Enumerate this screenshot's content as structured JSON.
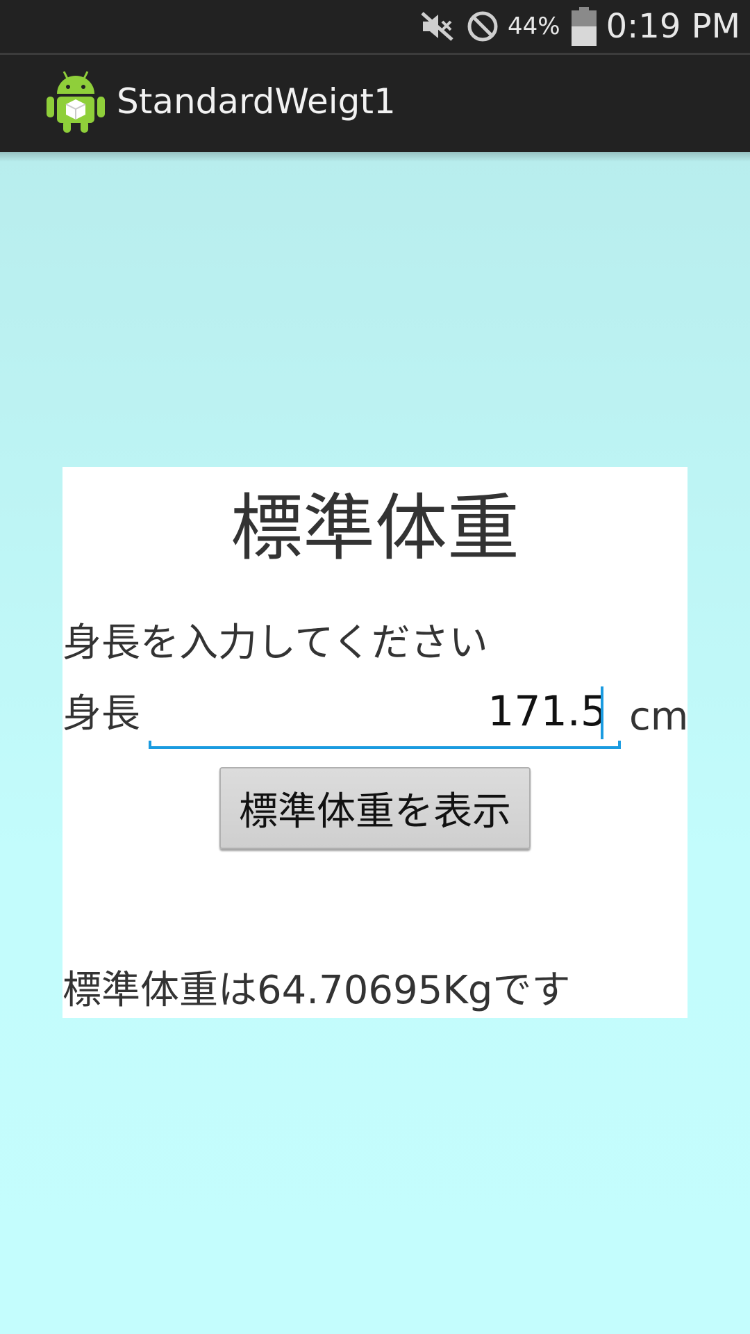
{
  "status_bar": {
    "icons": [
      "mute-icon",
      "blocked-icon",
      "battery-icon"
    ],
    "battery_percent": "44%",
    "time": "0:19 PM"
  },
  "action_bar": {
    "app_icon": "android-app-icon",
    "title": "StandardWeigt1"
  },
  "panel": {
    "title": "標準体重",
    "prompt": "身長を入力してください",
    "height_label": "身長",
    "height_value": "171.5",
    "unit": "cm",
    "button_label": "標準体重を表示",
    "result": "標準体重は64.70695Kgです"
  },
  "colors": {
    "bars": "#222222",
    "accent": "#1a9be0",
    "background": "#c4fdfd",
    "panel": "#ffffff"
  }
}
